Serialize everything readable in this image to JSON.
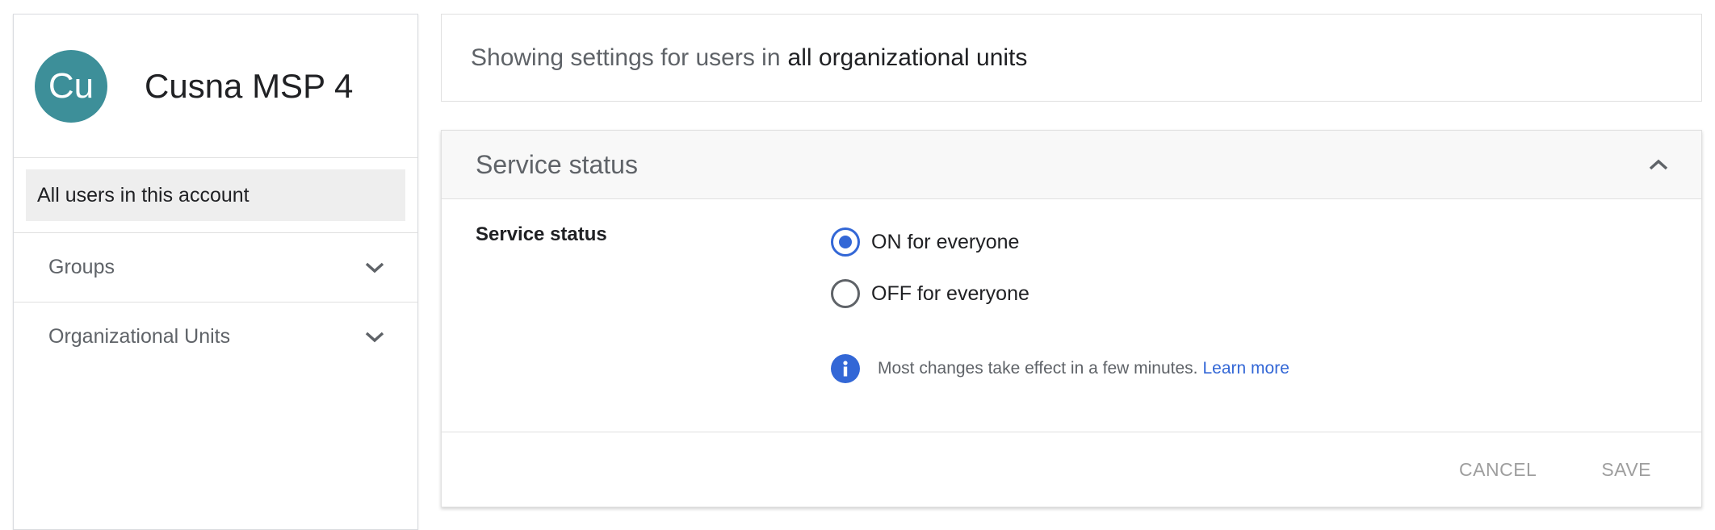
{
  "sidebar": {
    "avatar_initials": "Cu",
    "avatar_color": "#3d8f99",
    "account_name": "Cusna MSP 4",
    "all_users_label": "All users in this account",
    "sections": [
      {
        "label": "Groups",
        "icon": "chevron-down-icon"
      },
      {
        "label": "Organizational Units",
        "icon": "chevron-down-icon"
      }
    ]
  },
  "banner": {
    "prefix": "Showing settings for users in",
    "scope": "all organizational units"
  },
  "card": {
    "title": "Service status",
    "collapse_icon": "chevron-up-icon",
    "setting_label": "Service status",
    "options": [
      {
        "label": "ON for everyone",
        "selected": true
      },
      {
        "label": "OFF for everyone",
        "selected": false
      }
    ],
    "info_icon": "info-icon",
    "info_text": "Most changes take effect in a few minutes.",
    "learn_more": "Learn more",
    "cancel_label": "CANCEL",
    "save_label": "SAVE"
  },
  "colors": {
    "accent": "#3367d6",
    "selected_nav_bg": "#eeeeee",
    "disabled_button": "#9e9e9e"
  }
}
